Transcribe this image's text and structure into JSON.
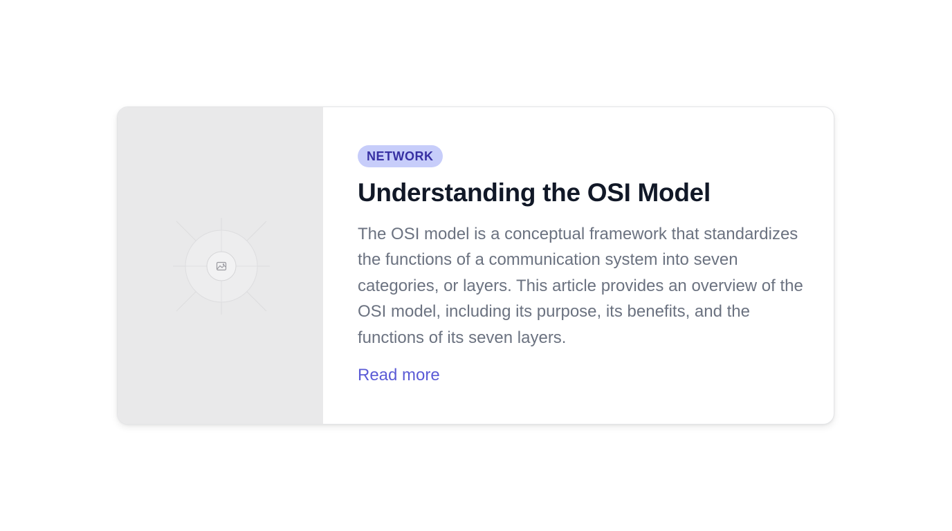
{
  "card": {
    "image_icon": "image-placeholder-icon",
    "badge": "NETWORK",
    "title": "Understanding the OSI Model",
    "description": "The OSI model is a conceptual framework that standardizes the functions of a communication system into seven categories, or layers. This article provides an overview of the OSI model, including its purpose, its benefits, and the functions of its seven layers.",
    "link_label": "Read more"
  },
  "colors": {
    "badge_bg": "#c7cdfa",
    "badge_text": "#3730a3",
    "title": "#111827",
    "body": "#6b7280",
    "link": "#5b5bd6",
    "image_bg": "#e9e9ea"
  }
}
